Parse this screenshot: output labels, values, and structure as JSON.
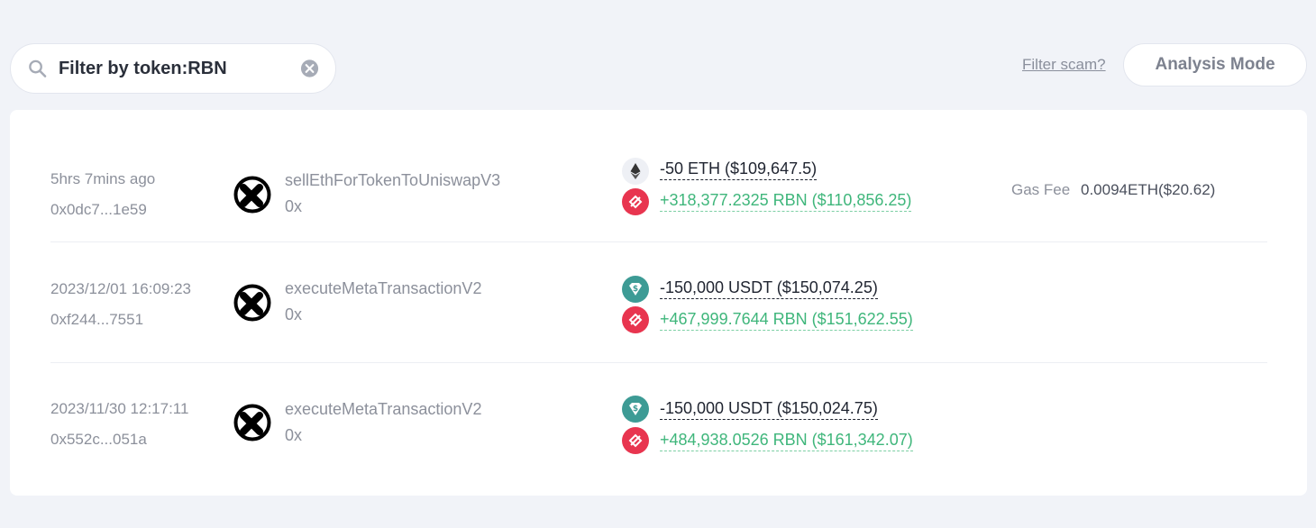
{
  "search": {
    "value": "Filter by token:RBN"
  },
  "header": {
    "filter_scam": "Filter scam?",
    "analysis_mode": "Analysis Mode"
  },
  "transactions": [
    {
      "time": "5hrs 7mins ago",
      "hash": "0x0dc7...1e59",
      "method": "sellEthForTokenToUniswapV3",
      "address": "0x",
      "out": {
        "icon": "eth-icon",
        "text": "-50 ETH ($109,647.5)"
      },
      "in": {
        "icon": "rbn-icon",
        "text": "+318,377.2325 RBN ($110,856.25)"
      },
      "gas_label": "Gas Fee",
      "gas_value": "0.0094ETH($20.62)"
    },
    {
      "time": "2023/12/01 16:09:23",
      "hash": "0xf244...7551",
      "method": "executeMetaTransactionV2",
      "address": "0x",
      "out": {
        "icon": "usdt-icon",
        "text": "-150,000 USDT ($150,074.25)"
      },
      "in": {
        "icon": "rbn-icon",
        "text": "+467,999.7644 RBN ($151,622.55)"
      }
    },
    {
      "time": "2023/11/30 12:17:11",
      "hash": "0x552c...051a",
      "method": "executeMetaTransactionV2",
      "address": "0x",
      "out": {
        "icon": "usdt-icon",
        "text": "-150,000 USDT ($150,024.75)"
      },
      "in": {
        "icon": "rbn-icon",
        "text": "+484,938.0526 RBN ($161,342.07)"
      }
    }
  ],
  "colors": {
    "out": "#1f2430",
    "in": "#3fb67b",
    "rbn": "#e8354f",
    "usdt": "#3d9b95"
  }
}
